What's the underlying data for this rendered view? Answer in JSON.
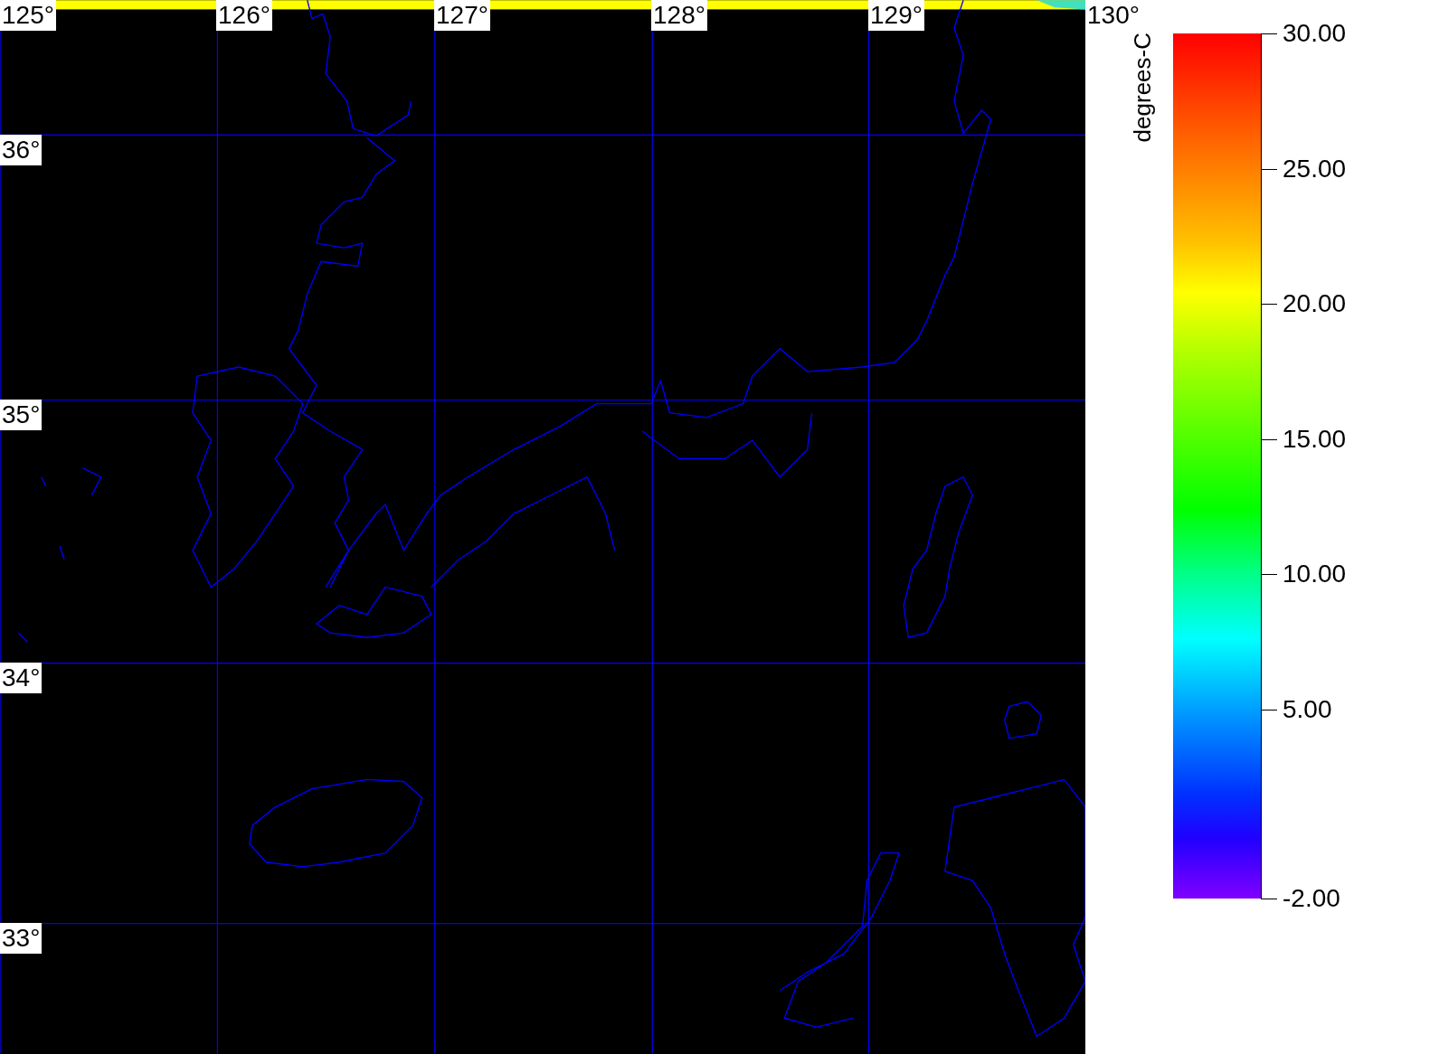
{
  "map": {
    "lon_labels": [
      "125°",
      "126°",
      "127°",
      "128°",
      "129°",
      "130°"
    ],
    "lat_labels": [
      "36°",
      "35°",
      "34°",
      "33°"
    ]
  },
  "colorbar": {
    "title": "degrees-C",
    "ticks": [
      "30.00",
      "25.00",
      "20.00",
      "15.00",
      "10.00",
      "5.00",
      "-2.00"
    ]
  }
}
